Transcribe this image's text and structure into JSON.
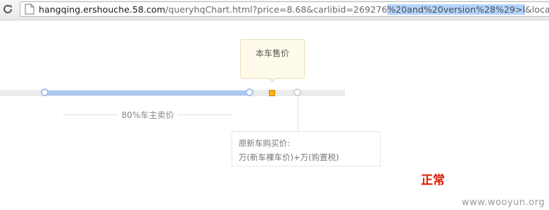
{
  "browser": {
    "url_domain": "hangqing.ershouche.58.com",
    "url_path": "/queryhqChart.html?price=8.68&carlibid=269276",
    "url_selected": "%20and%20version%28%29>l",
    "url_rest": "&localid=l&r"
  },
  "slider": {
    "price_label": "本车售价",
    "percent_label": "80%车主卖价"
  },
  "info_box": {
    "line1": "原新车购买价:",
    "line2": "万(新车裸车价)+万(购置税)"
  },
  "status": {
    "text": "正常",
    "color": "#dd1c00"
  },
  "watermark": {
    "text": "www.wooyun.org"
  },
  "icons": {
    "reload": "reload-icon",
    "page": "page-icon"
  }
}
